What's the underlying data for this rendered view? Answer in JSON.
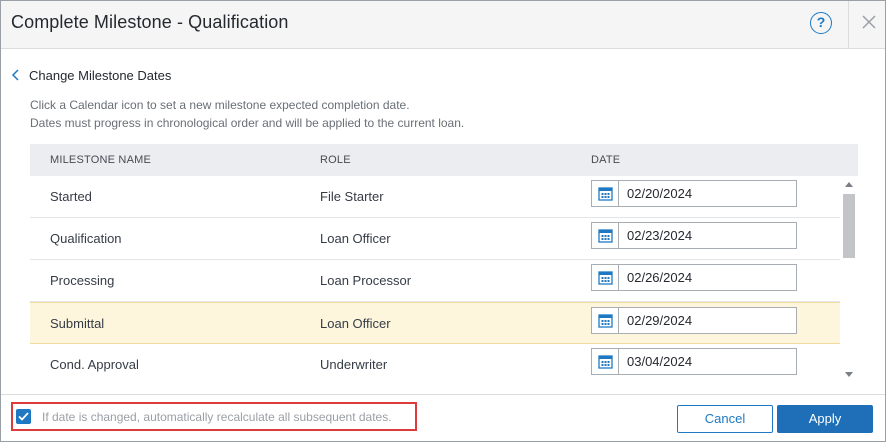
{
  "dialog": {
    "title": "Complete Milestone - Qualification",
    "help_glyph": "?"
  },
  "back_link": {
    "label": "Change Milestone Dates"
  },
  "instructions": {
    "line1": "Click a Calendar icon to set a new milestone expected completion date.",
    "line2": "Dates must progress in chronological order and will be applied to the current loan."
  },
  "table": {
    "headers": {
      "name": "MILESTONE NAME",
      "role": "ROLE",
      "date": "DATE"
    },
    "rows": [
      {
        "name": "Started",
        "role": "File Starter",
        "date": "02/20/2024",
        "highlighted": false
      },
      {
        "name": "Qualification",
        "role": "Loan Officer",
        "date": "02/23/2024",
        "highlighted": false
      },
      {
        "name": "Processing",
        "role": "Loan Processor",
        "date": "02/26/2024",
        "highlighted": false
      },
      {
        "name": "Submittal",
        "role": "Loan Officer",
        "date": "02/29/2024",
        "highlighted": true
      },
      {
        "name": "Cond. Approval",
        "role": "Underwriter",
        "date": "03/04/2024",
        "highlighted": false
      }
    ]
  },
  "footer": {
    "recalc_label": "If date is changed, automatically recalculate all subsequent dates.",
    "recalc_checked": true,
    "cancel_label": "Cancel",
    "apply_label": "Apply"
  },
  "colors": {
    "accent": "#1e79c2",
    "highlight_row": "#fdf6dd",
    "callout_border": "#dd3b3b"
  },
  "icons": [
    "help-icon",
    "close-icon",
    "chevron-left-icon",
    "calendar-icon",
    "checkmark-icon"
  ]
}
